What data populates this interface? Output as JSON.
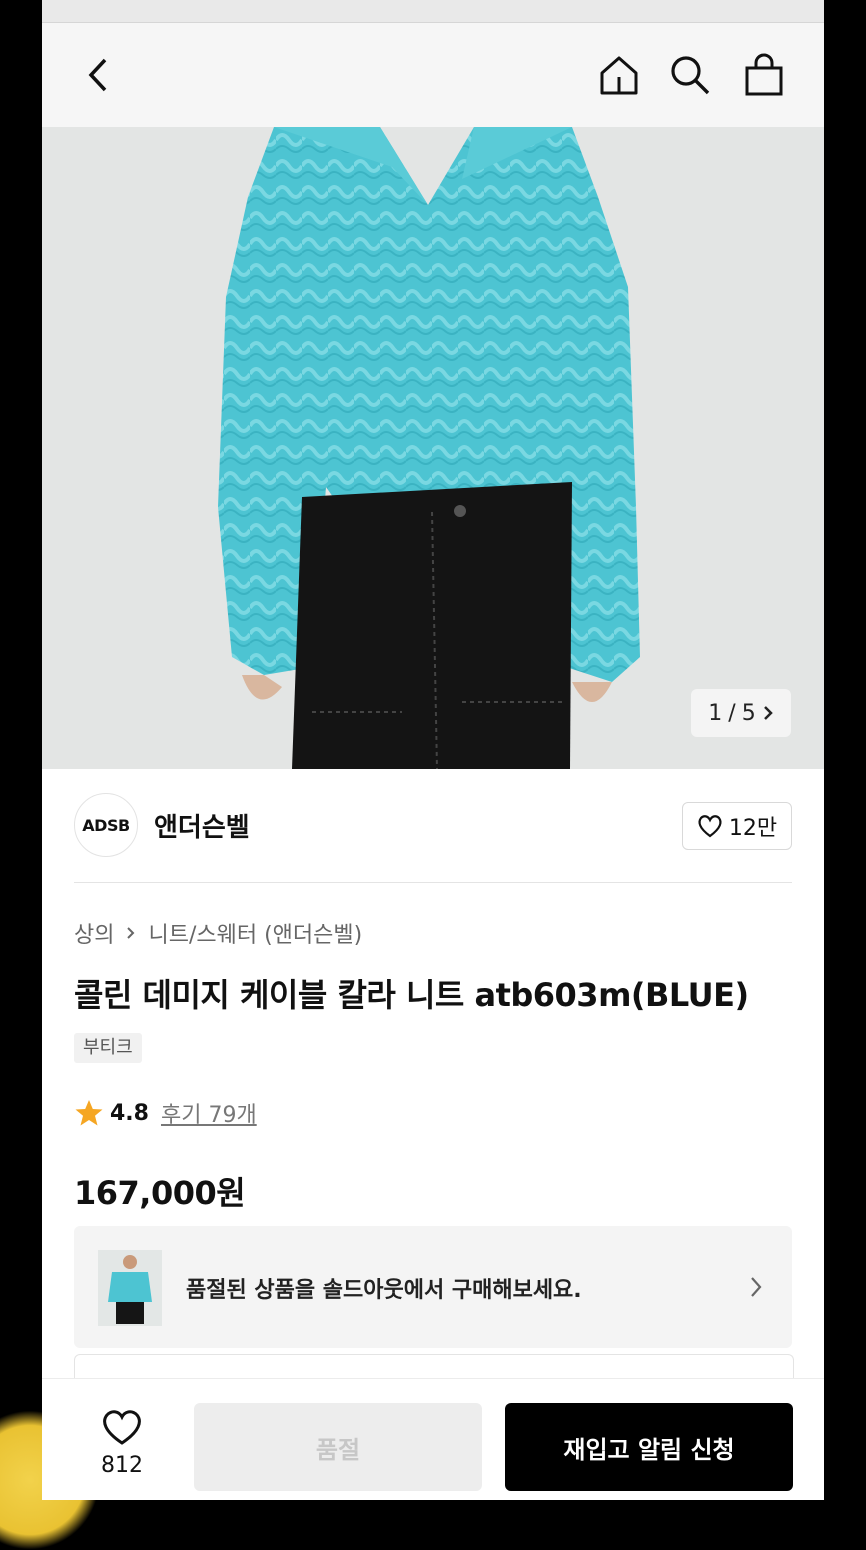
{
  "nav": {
    "back_icon": "chevron-left-icon",
    "home_icon": "home-icon",
    "search_icon": "search-icon",
    "bag_icon": "shopping-bag-icon"
  },
  "gallery": {
    "current": "1",
    "separator": "/",
    "total": "5"
  },
  "brand": {
    "logo_text": "ADSB",
    "name": "앤더슨벨",
    "likes": "12만"
  },
  "breadcrumb": {
    "category": "상의",
    "subcategory": "니트/스웨터 (앤더슨벨)"
  },
  "product": {
    "title": "콜린 데미지 케이블 칼라 니트 atb603m(BLUE)",
    "tag": "부티크",
    "rating": "4.8",
    "reviews": "후기 79개",
    "price": "167,000원"
  },
  "soldout_banner": {
    "text": "품절된 상품을 솔드아웃에서 구매해보세요."
  },
  "bottom": {
    "wish_count": "812",
    "soldout_label": "품절",
    "restock_label": "재입고 알림 신청"
  },
  "colors": {
    "sweater": "#4cc3d0",
    "primary_button": "#000000",
    "star": "#f5a623"
  }
}
